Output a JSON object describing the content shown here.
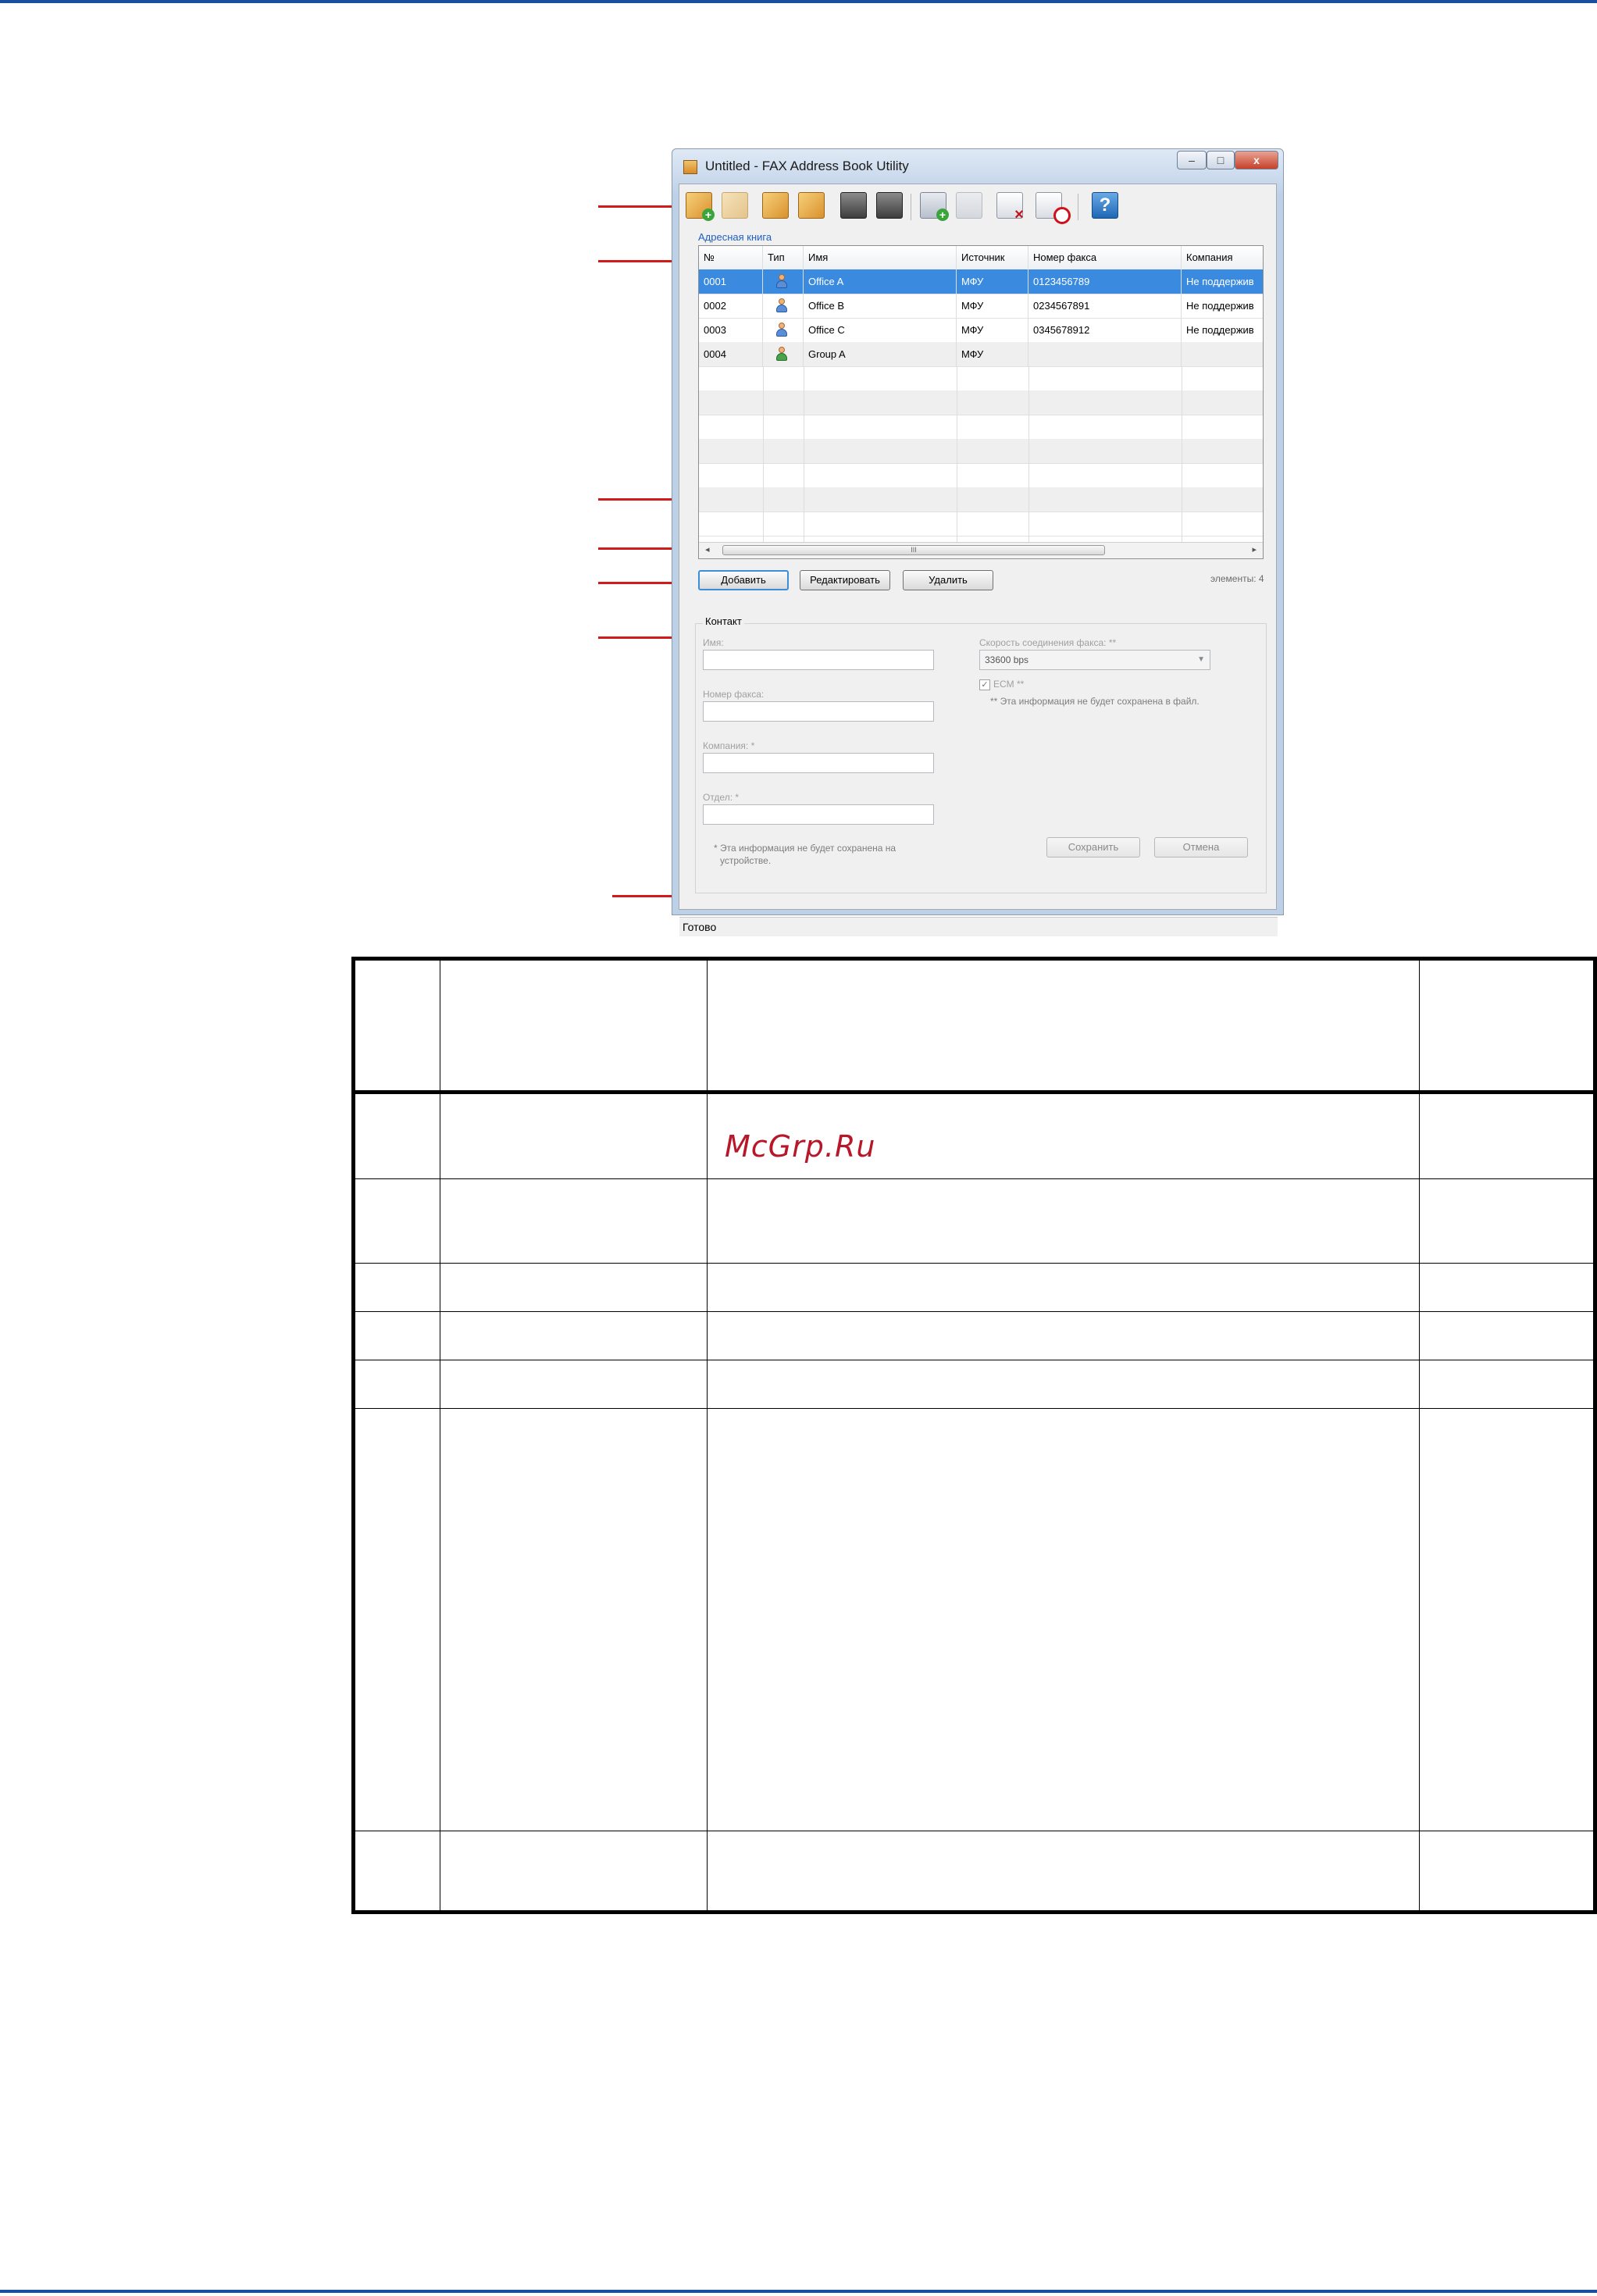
{
  "window": {
    "title": "Untitled - FAX Address Book Utility",
    "minimize": "–",
    "maximize": "□",
    "close": "x"
  },
  "toolbar": {
    "icons": [
      "new-book-icon",
      "open-book-icon",
      "save-book-icon",
      "edit-book-icon",
      "fax-icon",
      "fax-export-icon",
      "add-contact-icon",
      "add-group-icon",
      "delete-entry-icon",
      "delete-all-icon",
      "help-icon"
    ],
    "help_glyph": "?"
  },
  "address_book": {
    "label": "Адресная книга",
    "columns": [
      "№",
      "Тип",
      "Имя",
      "Источник",
      "Номер факса",
      "Компания"
    ],
    "rows": [
      {
        "no": "0001",
        "type": "contact",
        "name": "Office A",
        "source": "МФУ",
        "fax": "0123456789",
        "company": "Не поддержив"
      },
      {
        "no": "0002",
        "type": "contact",
        "name": "Office B",
        "source": "МФУ",
        "fax": "0234567891",
        "company": "Не поддержив"
      },
      {
        "no": "0003",
        "type": "contact",
        "name": "Office C",
        "source": "МФУ",
        "fax": "0345678912",
        "company": "Не поддержив"
      },
      {
        "no": "0004",
        "type": "group",
        "name": "Group A",
        "source": "МФУ",
        "fax": "",
        "company": ""
      }
    ],
    "scroll_thumb": "III"
  },
  "buttons": {
    "add": "Добавить",
    "edit": "Редактировать",
    "delete": "Удалить",
    "save": "Сохранить",
    "cancel": "Отмена"
  },
  "count_text": "элементы: 4",
  "contact": {
    "title": "Контакт",
    "name_label": "Имя:",
    "fax_label": "Номер факса:",
    "company_label": "Компания: *",
    "department_label": "Отдел: *",
    "speed_label": "Скорость соединения факса: **",
    "speed_value": "33600 bps",
    "ecm_label": "ECM **",
    "ecm_checked": true,
    "note_file": "** Эта информация не будет сохранена в файл.",
    "note_device_1": "* Эта информация не будет сохранена на",
    "note_device_2": "устройстве."
  },
  "status": "Готово",
  "watermark": "McGrp.Ru",
  "colors": {
    "callout": "#d11a1a",
    "selection": "#3a8be0",
    "rule": "#1a4fa0"
  }
}
